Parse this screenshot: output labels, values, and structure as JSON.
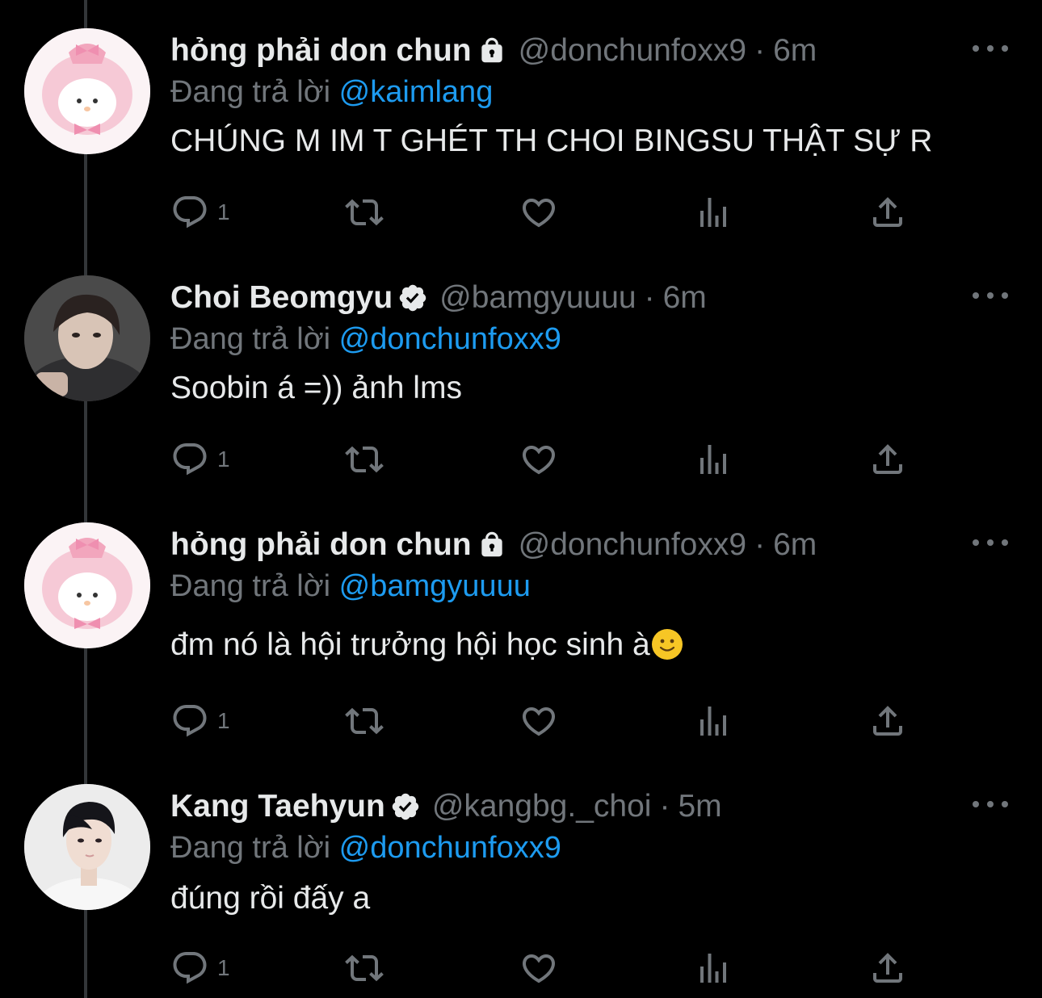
{
  "tweets": [
    {
      "name": "hỏng phải don chun",
      "badge": "lock-icon",
      "handle": "@donchunfoxx9",
      "separator": "·",
      "time": "6m",
      "replying_prefix": "Đang trả lời",
      "replying_to": "@kaimlang",
      "text": "CHÚNG M IM T GHÉT TH CHOI BINGSU THẬT SỰ R",
      "reply_count": "1"
    },
    {
      "name": "Choi Beomgyu",
      "badge": "verified-icon",
      "handle": "@bamgyuuuu",
      "separator": "·",
      "time": "6m",
      "replying_prefix": "Đang trả lời",
      "replying_to": "@donchunfoxx9",
      "text": "Soobin á =)) ảnh lms",
      "reply_count": "1"
    },
    {
      "name": "hỏng phải don chun",
      "badge": "lock-icon",
      "handle": "@donchunfoxx9",
      "separator": "·",
      "time": "6m",
      "replying_prefix": "Đang trả lời",
      "replying_to": "@bamgyuuuu",
      "text": "đm nó là hội trưởng hội học sinh à",
      "emoji": "slightly-smiling-face-emoji",
      "reply_count": "1"
    },
    {
      "name": "Kang Taehyun",
      "badge": "verified-icon",
      "handle": "@kangbg._choi",
      "separator": "·",
      "time": "5m",
      "replying_prefix": "Đang trả lời",
      "replying_to": "@donchunfoxx9",
      "text": "đúng rồi đấy a",
      "reply_count": "1"
    }
  ],
  "colors": {
    "background": "#000000",
    "text": "#e7e9ea",
    "muted": "#71767b",
    "link": "#1d9bf0",
    "thread_line": "#333639"
  }
}
